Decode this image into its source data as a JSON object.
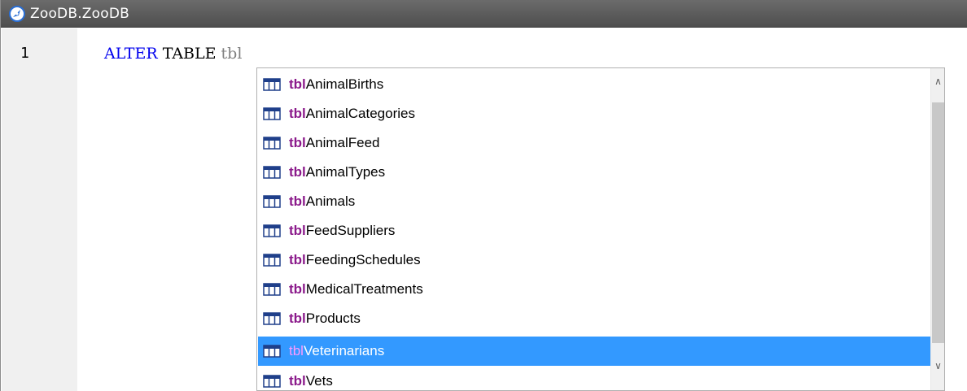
{
  "window": {
    "title": "ZooDB.ZooDB",
    "title_icon": "database-connection-icon"
  },
  "editor": {
    "line_number": "1",
    "keyword_alter": "ALTER",
    "keyword_table": "TABLE",
    "typed_text": "tbl",
    "colors": {
      "keyword": "#0000ee",
      "typed": "#808080",
      "prefix_highlight": "#8b1a8b",
      "selection": "#3399ff"
    }
  },
  "autocomplete": {
    "item_icon": "table-icon",
    "match_prefix": "tbl",
    "items": [
      {
        "prefix": "tbl",
        "rest": "AnimalBirths"
      },
      {
        "prefix": "tbl",
        "rest": "AnimalCategories"
      },
      {
        "prefix": "tbl",
        "rest": "AnimalFeed"
      },
      {
        "prefix": "tbl",
        "rest": "AnimalTypes"
      },
      {
        "prefix": "tbl",
        "rest": "Animals"
      },
      {
        "prefix": "tbl",
        "rest": "FeedSuppliers"
      },
      {
        "prefix": "tbl",
        "rest": "FeedingSchedules"
      },
      {
        "prefix": "tbl",
        "rest": "MedicalTreatments"
      },
      {
        "prefix": "tbl",
        "rest": "Products"
      },
      {
        "prefix": "tbl",
        "rest": "Veterinarians"
      },
      {
        "prefix": "tbl",
        "rest": "Vets"
      }
    ],
    "selected_item": "tblVeterinarians"
  }
}
